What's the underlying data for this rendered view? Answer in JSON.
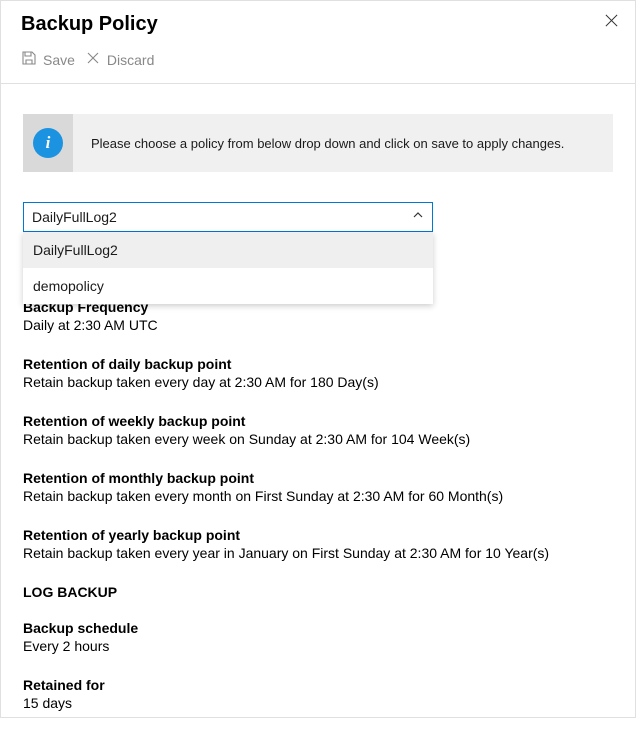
{
  "title": "Backup Policy",
  "toolbar": {
    "save_label": "Save",
    "discard_label": "Discard"
  },
  "banner": {
    "text": "Please choose a policy from below drop down and click on save to apply changes."
  },
  "dropdown": {
    "selected": "DailyFullLog2",
    "options": [
      "DailyFullLog2",
      "demopolicy"
    ]
  },
  "details": {
    "backup_frequency": {
      "heading": "Backup Frequency",
      "value": "Daily at 2:30 AM UTC"
    },
    "retention_daily": {
      "heading": "Retention of daily backup point",
      "value": "Retain backup taken every day at 2:30 AM for 180 Day(s)"
    },
    "retention_weekly": {
      "heading": "Retention of weekly backup point",
      "value": "Retain backup taken every week on Sunday at 2:30 AM for 104 Week(s)"
    },
    "retention_monthly": {
      "heading": "Retention of monthly backup point",
      "value": "Retain backup taken every month on First Sunday at 2:30 AM for 60 Month(s)"
    },
    "retention_yearly": {
      "heading": "Retention of yearly backup point",
      "value": "Retain backup taken every year in January on First Sunday at 2:30 AM for 10 Year(s)"
    },
    "log_backup_heading": "LOG BACKUP",
    "backup_schedule": {
      "heading": "Backup schedule",
      "value": "Every 2 hours"
    },
    "retained_for": {
      "heading": "Retained for",
      "value": "15 days"
    }
  }
}
